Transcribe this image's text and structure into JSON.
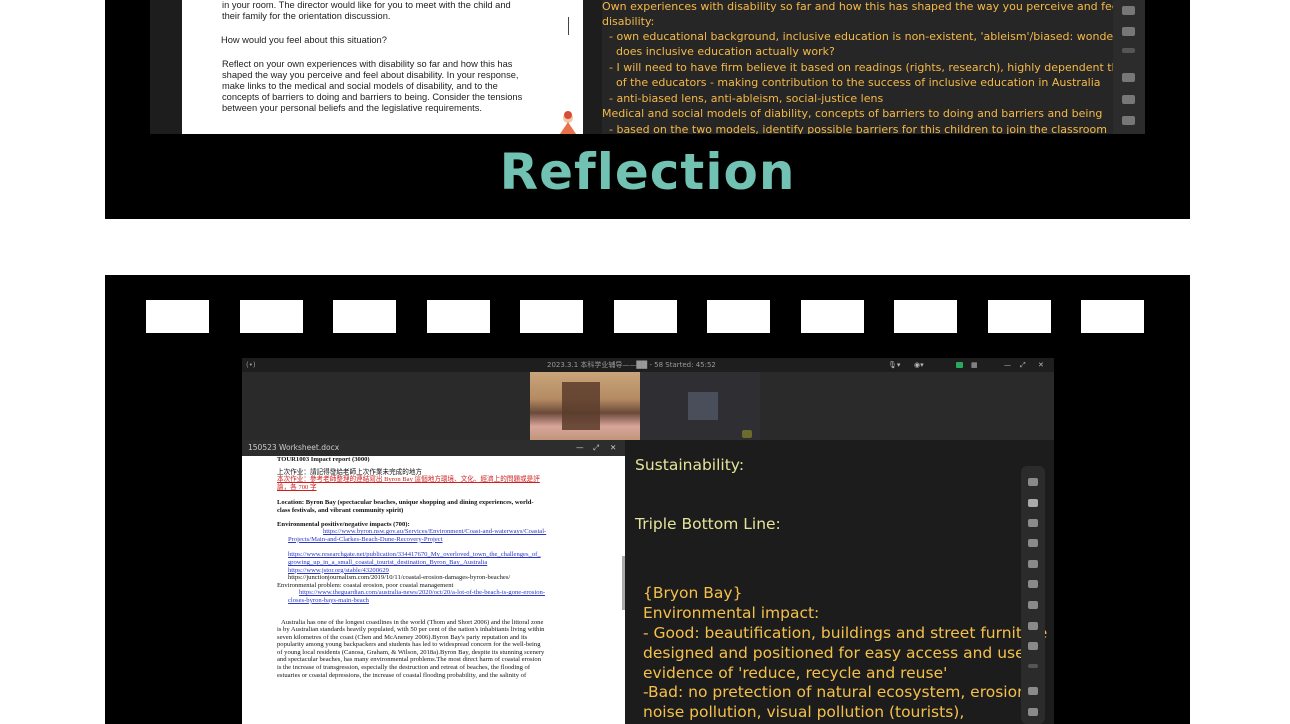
{
  "top_panel": {
    "doc_lines": [
      "in your room. The director would like for you to meet with the child and",
      "their family for the orientation discussion."
    ],
    "doc_question": "How would you feel about this situation?",
    "doc_prompt": [
      "Reflect on your own experiences with disability so far and how this has",
      "shaped the way you perceive and feel about disability. In your response,",
      "make links to the medical and social models of disability, and to the",
      "concepts of barriers to doing and barriers to being. Consider the tensions",
      "between your personal beliefs and the legislative requirements."
    ],
    "notes_lines": [
      "Own experiences with disability so far and how this has shaped the way you perceive and feel about",
      "disability:",
      "  - own educational background, inclusive education is non-existent, 'ableism'/biased: wonderings",
      "    does inclusive education actually work?",
      "  - I will need to have firm believe it based on readings (rights, research), highly dependent the attitude",
      "    of the educators - making contribution to the success of inclusive education in Australia",
      "  - anti-biased lens, anti-ableism, social-justice lens",
      "Medical and social models of diability, concepts of barriers to doing and barriers and being",
      "  - based on the two models, identify possible barriers for this children to join the classroom"
    ],
    "title": "Reflection"
  },
  "app": {
    "window_title": "2023.3.1 本科学业辅导——██ - 58   Started: 45:52",
    "doc_window_title": "150523 Worksheet.docx",
    "doc": {
      "heading": "TOUR1003 Impact report (3000)",
      "chinese_1": "上次作业：請記得發給老師上次作業未完成的地方",
      "chinese_2": "本次作业：參考老師整理的連結寫出 Byron Bay 這個地方環境、文化、經濟上的問題或是評",
      "chinese_3": "論，各 700 字",
      "location": "Location: Byron Bay (spectacular beaches, unique shopping and dining experiences, world-",
      "location_2": "class festivals, and vibrant community spirit)",
      "env_heading": "Environmental positive/negative impacts (700):",
      "links": [
        "https://www.byron.nsw.gov.au/Services/Environment/Coast-and-waterways/Coastal-",
        "Projects/Main-and-Clarkes-Beach-Dune-Recovery-Project",
        "https://www.researchgate.net/publication/334417670_My_overloved_town_the_challenges_of_",
        "growing_up_in_a_small_coastal_tourist_destination_Byron_Bay_Australia",
        "https://www.jstor.org/stable/43200629",
        "https://junctionjournalism.com/2019/10/11/coastal-erosion-damages-byron-beaches/",
        "https://www.theguardian.com/australia-news/2020/oct/20/a-lot-of-the-beach-is-gone-erosion-",
        "closes-byron-bays-main-beach"
      ],
      "env_problem": "Environmental problem: coastal erosion, poor coastal management",
      "para": [
        "Australia has one of the longest coastlines in the world (Thom and Short 2006) and the littoral zone",
        "is by Australian standards heavily populated, with 50 per cent of the nation's inhabitants living within",
        "seven kilometres of the coast (Chen and McAneney 2006).Byron Bay's party reputation and its",
        "popularity among young backpackers and students has led to widespread concern for the well-being",
        "of young local residents (Canosa, Graham, & Wilson, 2018a).Byron Bay, despite its stunning scenery",
        "and spectacular beaches, has many environmental problems.The most direct harm of coastal erosion",
        "is the increase of transgression, especially the destruction and retreat of beaches, the flooding of",
        "estuaries or coastal depressions, the increase of coastal flooding probability, and the salinity of"
      ]
    },
    "notes": {
      "sustainability": "Sustainability:",
      "triple": "Triple Bottom Line:",
      "lines": [
        "{Bryon Bay}",
        "Environmental impact:",
        "- Good: beautification, buildings and street furniture",
        "designed and positioned for easy access and use,",
        "evidence of 'reduce, recycle and reuse'",
        "-Bad: no pretection of natural ecosystem, erosion,",
        "noise pollution, visual pollution (tourists),"
      ]
    }
  }
}
